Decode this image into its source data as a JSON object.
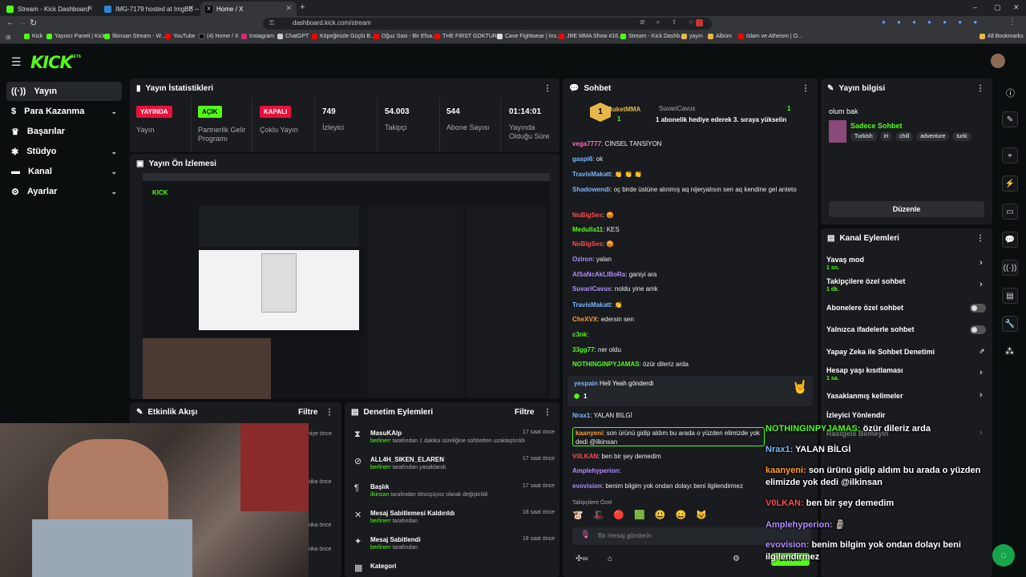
{
  "browser": {
    "tabs": [
      {
        "label": "Stream - Kick Dashboard",
        "color": "#53fc18"
      },
      {
        "label": "IMG-7179 hosted at ImgBB — ImgBB",
        "color": "#2f86d7"
      },
      {
        "label": "Home / X",
        "color": "#000000"
      }
    ],
    "url": "dashboard.kick.com/stream",
    "bookmarks": [
      "Kick",
      "Yayıncı Paneli | Kick",
      "İlkinsan Stream - W...",
      "YouTube",
      "(4) Home / X",
      "Instagram",
      "ChatGPT",
      "Köpeğinizle Güçlü B...",
      "Oğuz Sasi - Bir Efsa...",
      "THE FIRST GOKTUR...",
      "Cave Fightwear | Ins...",
      "JRE MMA Show #16...",
      "Stream - Kick Dashb...",
      "yayın",
      "Albüm",
      "Islam ve Atheism | O..."
    ],
    "all_bookmarks": "All Bookmarks"
  },
  "app": {
    "logo": "KICK",
    "beta": "BETA",
    "accent": "#53fc18"
  },
  "sidebar": {
    "items": [
      {
        "label": "Yayın",
        "icon": "broadcast-icon"
      },
      {
        "label": "Para Kazanma",
        "icon": "money-icon"
      },
      {
        "label": "Başarılar",
        "icon": "trophy-icon"
      },
      {
        "label": "Stüdyo",
        "icon": "studio-icon"
      },
      {
        "label": "Kanal",
        "icon": "channel-icon"
      },
      {
        "label": "Ayarlar",
        "icon": "gear-icon"
      }
    ]
  },
  "stats": {
    "title": "Yayın İstatistikleri",
    "items": [
      {
        "badge": "YAYINDA",
        "label": "Yayın"
      },
      {
        "badge": "AÇIK",
        "label": "Partnerlik Gelir Programı"
      },
      {
        "badge": "KAPALI",
        "label": "Çoklu Yayın"
      },
      {
        "value": "749",
        "label": "İzleyici"
      },
      {
        "value": "54.003",
        "label": "Takipçi"
      },
      {
        "value": "544",
        "label": "Abone Sayısı"
      },
      {
        "value": "01:14:01",
        "label": "Yayında Olduğu Süre"
      }
    ]
  },
  "preview": {
    "title": "Yayın Ön İzlemesi"
  },
  "activity": {
    "title": "Etkinlik Akışı",
    "filter": "Filtre",
    "times": [
      "niye önce",
      "kika önce",
      "kika önce",
      "kika önce"
    ]
  },
  "moderation": {
    "title": "Denetim Eylemleri",
    "filter": "Filtre",
    "items": [
      {
        "icon": "hourglass-icon",
        "title": "MasuKAlp",
        "user": "berlinerr",
        "desc": " tarafından 1 dakika süreliğine sohbetten uzaklaştırıldı",
        "time": "17 saat önce"
      },
      {
        "icon": "ban-icon",
        "title": "ALL4H_SIKEN_ELAREN",
        "user": "berlinerr",
        "desc": " tarafından yasaklandı",
        "time": "17 saat önce"
      },
      {
        "icon": "title-icon",
        "title": "Başlık",
        "user": "ilkinsan",
        "desc": " tarafından dövüşüyoz olarak değiştirildi",
        "time": "17 saat önce"
      },
      {
        "icon": "unpin-icon",
        "title": "Mesaj Sabitlemesi Kaldırıldı",
        "user": "berlinerr",
        "desc": " tarafından",
        "time": "18 saat önce"
      },
      {
        "icon": "pin-icon",
        "title": "Mesaj Sabitlendi",
        "user": "berlinerr",
        "desc": " tarafından",
        "time": "18 saat önce"
      },
      {
        "icon": "category-icon",
        "title": "Kategori",
        "user": "",
        "desc": "",
        "time": ""
      }
    ]
  },
  "chat": {
    "title": "Sohbet",
    "pinned": {
      "count": "1",
      "sender": "BuketMMA",
      "sender_count": "1",
      "user": "SuvariCavus",
      "text": "1 abonelik hediye ederek 3. sıraya yükselin",
      "user_count": "1"
    },
    "messages": [
      {
        "user": "vega7777",
        "color": "#ff6fb5",
        "text": "CİNSEL TANSİYON"
      },
      {
        "user": "gaspi6",
        "color": "#7ab8ff",
        "text": "ok"
      },
      {
        "user": "TravisMakatt",
        "color": "#7ab8ff",
        "text": "👏 👏 👏"
      },
      {
        "user": "Shadowendi",
        "color": "#7ab8ff",
        "text": "oç birde üstüne alınmış aq nijeryalısın sen aq kendine gel anteto"
      },
      {
        "user": "NoBigSes",
        "color": "#ff4d4d",
        "text": "😡"
      },
      {
        "user": "Medulla11",
        "color": "#53fc18",
        "text": "KES"
      },
      {
        "user": "NoBigSes",
        "color": "#ff4d4d",
        "text": "😡"
      },
      {
        "user": "Oziron",
        "color": "#b18cff",
        "text": "yalan"
      },
      {
        "user": "AlSaNcAkLIBoRa",
        "color": "#b18cff",
        "text": "ganiyi ara"
      },
      {
        "user": "SuvariCavus",
        "color": "#b18cff",
        "text": "noldu yine amk"
      },
      {
        "user": "TravisMakatt",
        "color": "#7ab8ff",
        "text": "👏"
      },
      {
        "user": "CheXVX",
        "color": "#ff9e2c",
        "text": "edersin sen"
      },
      {
        "user": "c3nk",
        "color": "#53fc18",
        "text": ""
      },
      {
        "user": "33gg77",
        "color": "#53fc18",
        "text": "ner oldu"
      },
      {
        "user": "NOTHINGINPYJAMAS",
        "color": "#53fc18",
        "text": "özür dileriz arda"
      }
    ],
    "gift": {
      "user": "yespain",
      "text": " Hell Yeah gönderdi",
      "count": "1"
    },
    "after": [
      {
        "user": "Nrax1",
        "color": "#7ab8ff",
        "text": "YALAN BİLGİ"
      },
      {
        "user": "kaanyeni",
        "color": "#ff9e2c",
        "text": "son ürünü gidip aldım bu arada o yüzden elimizde yok dedi @ilkinsan"
      },
      {
        "user": "V0LKAN",
        "color": "#ff4d4d",
        "text": "ben bir şey demedim"
      },
      {
        "user": "Amplehyperion",
        "color": "#b18cff",
        "text": ""
      },
      {
        "user": "evovision",
        "color": "#b18cff",
        "text": "benim bilgim yok ondan dolayı beni ilgilendirmez"
      }
    ],
    "followers_only": "Takipçilere Özel",
    "input_placeholder": "Bir mesaj gönderin",
    "send": "Sohbet"
  },
  "stream_info": {
    "title": "Yayın bilgisi",
    "stream_title": "olum bak",
    "category": "Sadece Sohbet",
    "tags": [
      "Turkish",
      "iri",
      "chill",
      "adventure",
      "turki"
    ],
    "edit": "Düzenle"
  },
  "channel_actions": {
    "title": "Kanal Eylemleri",
    "items": [
      {
        "label": "Yavaş mod",
        "sub": "1 sn.",
        "control": "chevron"
      },
      {
        "label": "Takipçilere özel sohbet",
        "sub": "1 dk.",
        "control": "chevron"
      },
      {
        "label": "Abonelere özel sohbet",
        "sub": "",
        "control": "toggle"
      },
      {
        "label": "Yalnızca ifadelerle sohbet",
        "sub": "",
        "control": "toggle"
      },
      {
        "label": "Yapay Zeka ile Sohbet Denetimi",
        "sub": "",
        "control": "external"
      },
      {
        "label": "Hesap yaşı kısıtlaması",
        "sub": "1 sa.",
        "control": "chevron"
      },
      {
        "label": "Yasaklanmış kelimeler",
        "sub": "",
        "control": "chevron"
      },
      {
        "label": "İzleyici Yönlendir",
        "sub": "",
        "control": ""
      },
      {
        "label": "Rastgele Bemeyin",
        "sub": "",
        "control": "chevron"
      }
    ]
  },
  "overlay_chat": [
    {
      "user": "NOTHINGINPYJAMAS",
      "color": "#53fc18",
      "text": "özür dileriz arda"
    },
    {
      "user": "Nrax1",
      "color": "#7ab8ff",
      "text": "YALAN BİLGİ"
    },
    {
      "user": "kaanyeni",
      "color": "#ff9e2c",
      "text": "son ürünü gidip aldım bu arada o yüzden elimizde yok dedi @ilkinsan"
    },
    {
      "user": "V0LKAN",
      "color": "#ff4d4d",
      "text": "ben bir şey demedim"
    },
    {
      "user": "Amplehyperion",
      "color": "#b18cff",
      "text": "🗿"
    },
    {
      "user": "evovision",
      "color": "#b18cff",
      "text": "benim bilgim yok ondan dolayı beni ilgilendirmez"
    }
  ]
}
